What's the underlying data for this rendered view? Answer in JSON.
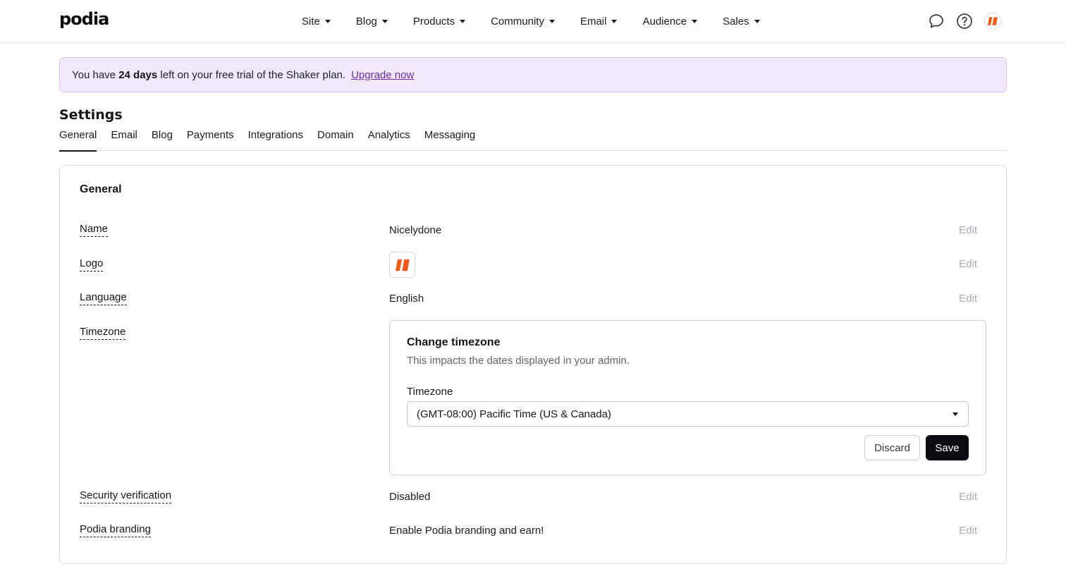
{
  "brand": {
    "name": "podia",
    "accent": "#f05a1a"
  },
  "nav": {
    "items": [
      "Site",
      "Blog",
      "Products",
      "Community",
      "Email",
      "Audience",
      "Sales"
    ],
    "icons": [
      "chat-icon",
      "help-icon",
      "avatar-logo-icon"
    ]
  },
  "banner": {
    "prefix": "You have ",
    "days": "24 days",
    "suffix": " left on your free trial of the Shaker plan.",
    "link": "Upgrade now"
  },
  "settings": {
    "title": "Settings",
    "tabs": [
      "General",
      "Email",
      "Blog",
      "Payments",
      "Integrations",
      "Domain",
      "Analytics",
      "Messaging"
    ],
    "active_tab": "General"
  },
  "general": {
    "title": "General",
    "edit_label": "Edit",
    "rows": {
      "name": {
        "label": "Name",
        "value": "Nicelydone"
      },
      "logo": {
        "label": "Logo"
      },
      "language": {
        "label": "Language",
        "value": "English"
      },
      "timezone": {
        "label": "Timezone"
      },
      "security": {
        "label": "Security verification",
        "value": "Disabled"
      },
      "branding": {
        "label": "Podia branding",
        "value": "Enable Podia branding and earn!"
      }
    }
  },
  "timezone_panel": {
    "title": "Change timezone",
    "description": "This impacts the dates displayed in your admin.",
    "field_label": "Timezone",
    "selected": "(GMT-08:00) Pacific Time (US & Canada)",
    "discard_label": "Discard",
    "save_label": "Save"
  }
}
